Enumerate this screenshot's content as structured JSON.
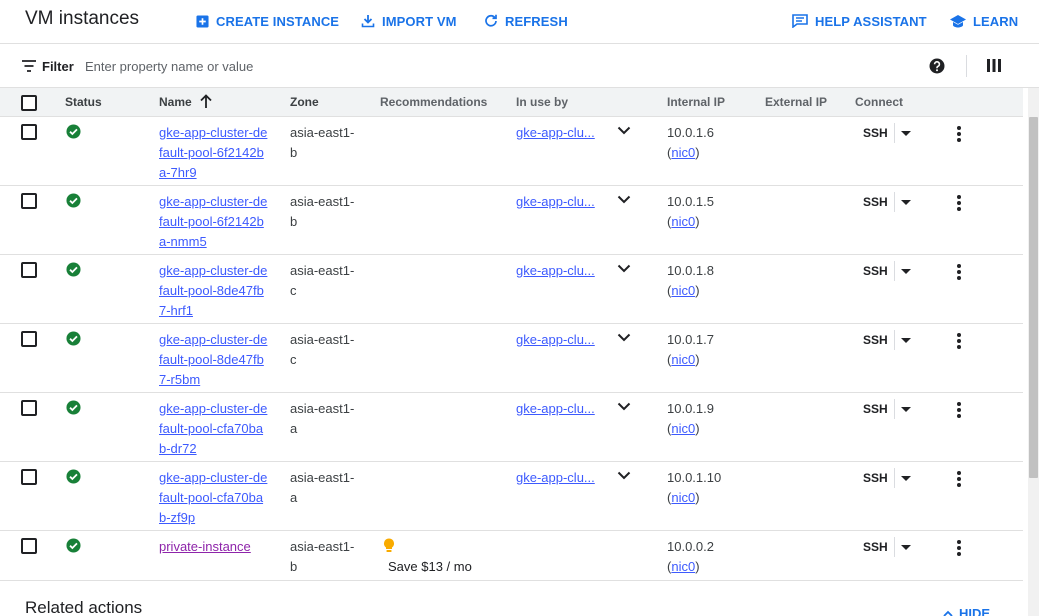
{
  "header": {
    "title": "VM instances",
    "create_label": "CREATE INSTANCE",
    "import_label": "IMPORT VM",
    "refresh_label": "REFRESH",
    "help_label": "HELP ASSISTANT",
    "learn_label": "LEARN"
  },
  "filter": {
    "label": "Filter",
    "placeholder": "Enter property name or value"
  },
  "table": {
    "columns": {
      "status": "Status",
      "name": "Name",
      "zone": "Zone",
      "recommendations": "Recommendations",
      "in_use_by": "In use by",
      "internal_ip": "Internal IP",
      "external_ip": "External IP",
      "connect": "Connect"
    },
    "sort": "ascending",
    "rows": [
      {
        "name": "gke-app-cluster-default-pool-6f2142ba-7hr9",
        "zone": "asia-east1-b",
        "in_use_by": "gke-app-clu...",
        "internal_ip": "10.0.1.6",
        "nic": "nic0",
        "connect": "SSH",
        "status": "running"
      },
      {
        "name": "gke-app-cluster-default-pool-6f2142ba-nmm5",
        "zone": "asia-east1-b",
        "in_use_by": "gke-app-clu...",
        "internal_ip": "10.0.1.5",
        "nic": "nic0",
        "connect": "SSH",
        "status": "running"
      },
      {
        "name": "gke-app-cluster-default-pool-8de47fb7-hrf1",
        "zone": "asia-east1-c",
        "in_use_by": "gke-app-clu...",
        "internal_ip": "10.0.1.8",
        "nic": "nic0",
        "connect": "SSH",
        "status": "running"
      },
      {
        "name": "gke-app-cluster-default-pool-8de47fb7-r5bm",
        "zone": "asia-east1-c",
        "in_use_by": "gke-app-clu...",
        "internal_ip": "10.0.1.7",
        "nic": "nic0",
        "connect": "SSH",
        "status": "running"
      },
      {
        "name": "gke-app-cluster-default-pool-cfa70bab-dr72",
        "zone": "asia-east1-a",
        "in_use_by": "gke-app-clu...",
        "internal_ip": "10.0.1.9",
        "nic": "nic0",
        "connect": "SSH",
        "status": "running"
      },
      {
        "name": "gke-app-cluster-default-pool-cfa70bab-zf9p",
        "zone": "asia-east1-a",
        "in_use_by": "gke-app-clu...",
        "internal_ip": "10.0.1.10",
        "nic": "nic0",
        "connect": "SSH",
        "status": "running"
      },
      {
        "name": "private-instance",
        "zone": "asia-east1-b",
        "recommendation": "Save $13 / mo",
        "internal_ip": "10.0.0.2",
        "nic": "nic0",
        "connect": "SSH",
        "status": "running"
      }
    ]
  },
  "footer": {
    "related_title": "Related actions",
    "hide_label": "HIDE"
  },
  "colors": {
    "accent": "#1a73e8",
    "link": "#3d5afe",
    "visited_link": "#8e24aa",
    "status_ok": "#188038",
    "recommendation": "#f9ab00"
  }
}
